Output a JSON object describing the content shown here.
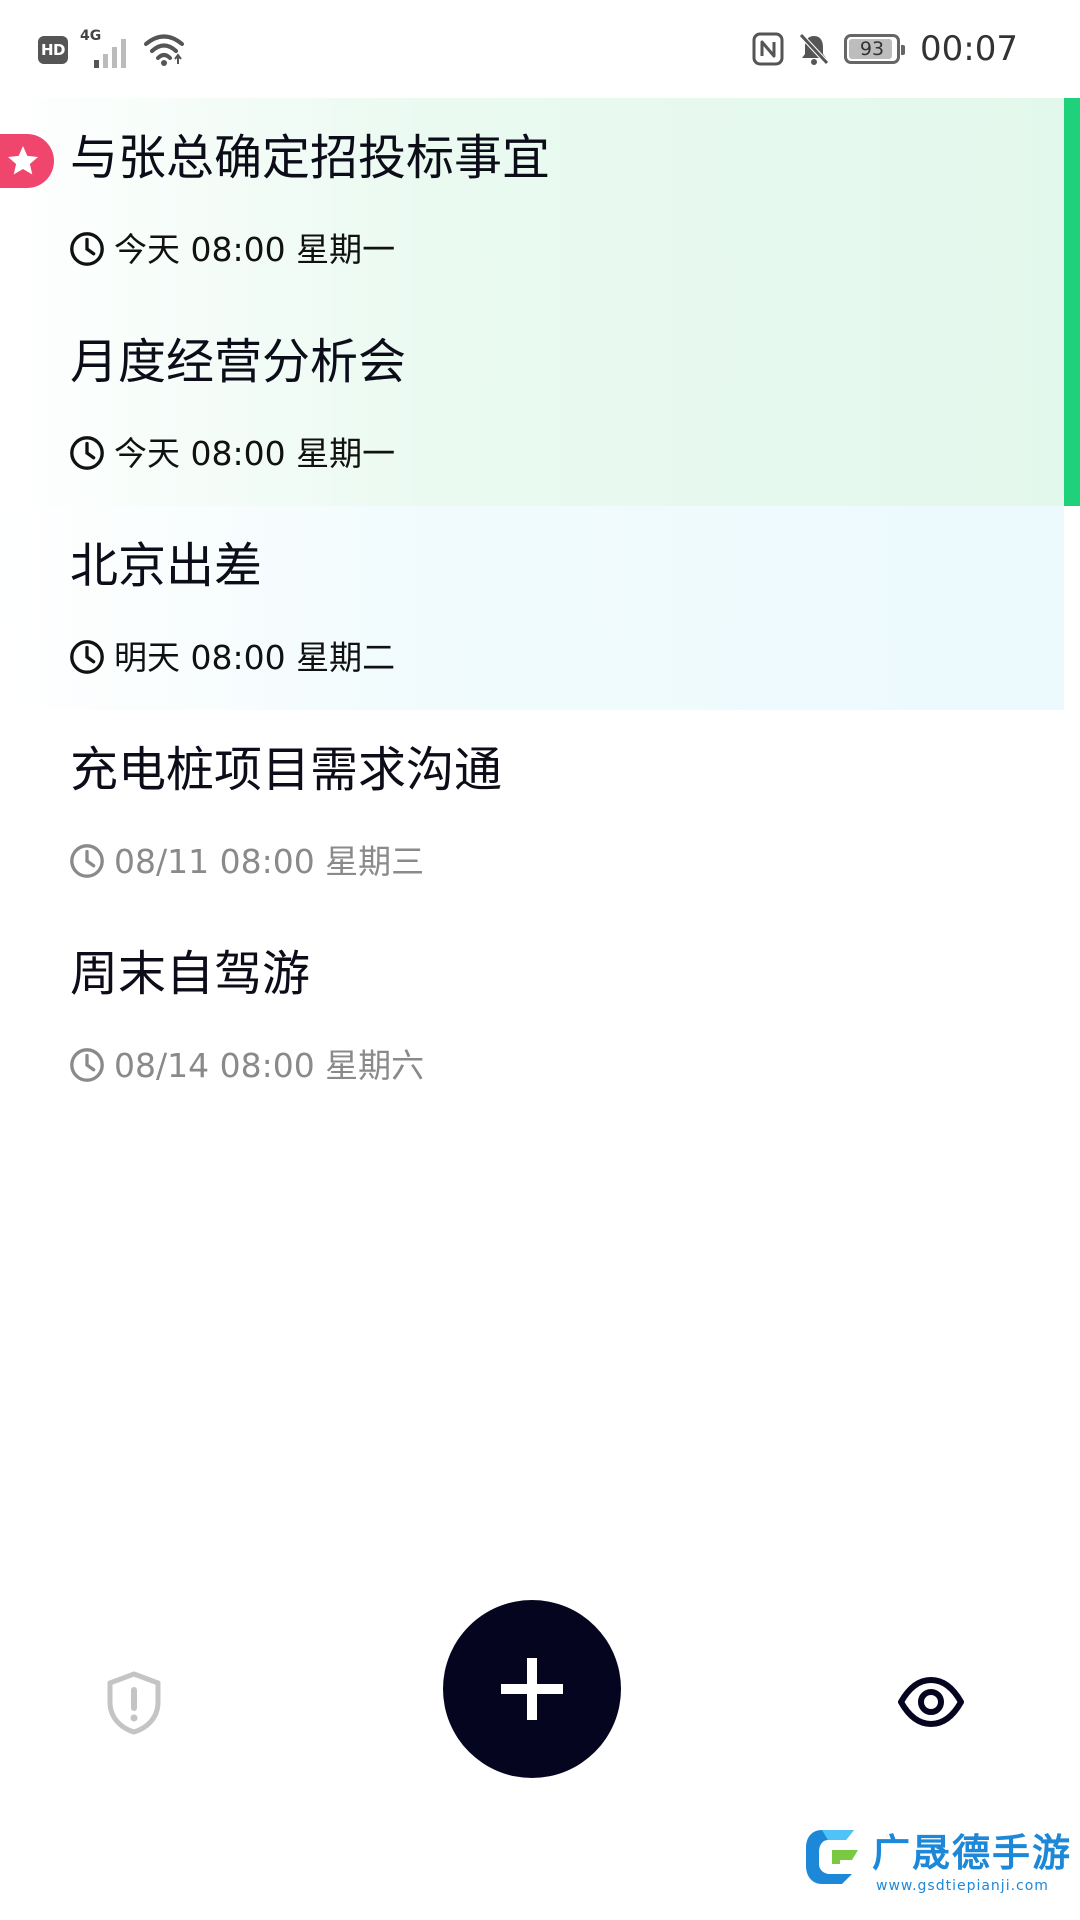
{
  "status_bar": {
    "hd_label": "HD",
    "network_type": "4G",
    "battery_level": "93",
    "battery_fraction": 0.93,
    "time": "00:07",
    "icons": [
      "hd-icon",
      "signal-icon",
      "wifi-icon",
      "nfc-icon",
      "bell-off-icon",
      "battery-icon"
    ]
  },
  "tasks": [
    {
      "title": "与张总确定招投标事宜",
      "time": "今天 08:00 星期一",
      "group": "today",
      "starred": true
    },
    {
      "title": "月度经营分析会",
      "time": "今天 08:00 星期一",
      "group": "today",
      "starred": false
    },
    {
      "title": "北京出差",
      "time": "明天 08:00 星期二",
      "group": "tomorrow",
      "starred": false
    },
    {
      "title": "充电桩项目需求沟通",
      "time": "08/11 08:00 星期三",
      "group": "future",
      "starred": false
    },
    {
      "title": "周末自驾游",
      "time": "08/14 08:00 星期六",
      "group": "future",
      "starred": false
    }
  ],
  "bottom_bar": {
    "left_icon": "shield-alert-icon",
    "center_icon": "plus-icon",
    "right_icon": "eye-icon"
  },
  "watermark": {
    "title": "广晟德手游",
    "url": "www.gsdtiepianji.com"
  },
  "colors": {
    "accent_green": "#1ed17a",
    "star_badge": "#f0456d",
    "fab": "#050520",
    "title_text": "#0d0d1a",
    "muted_text": "#8a8a8a"
  }
}
